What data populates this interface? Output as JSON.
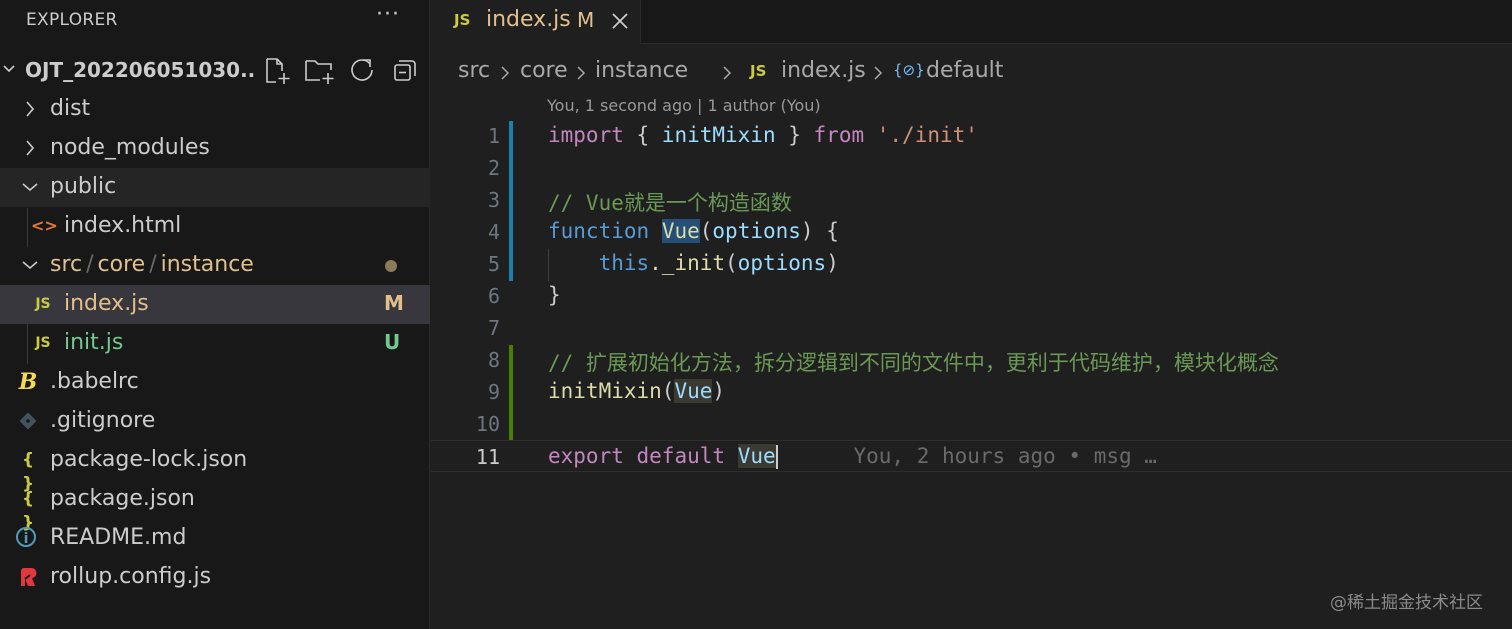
{
  "explorer": {
    "title": "EXPLORER",
    "more": "···",
    "project_name": "OJT_202206051030...",
    "items": [
      {
        "label": "dist",
        "icon": "chevron-right"
      },
      {
        "label": "node_modules",
        "icon": "chevron-right"
      },
      {
        "label": "public",
        "icon": "chevron-down"
      },
      {
        "label": "index.html",
        "icon": "html-icon"
      },
      {
        "label_parts": [
          "src",
          "core",
          "instance"
        ],
        "separator": "/",
        "icon": "chevron-down"
      },
      {
        "label": "index.js",
        "icon": "js-icon",
        "badge": "M"
      },
      {
        "label": "init.js",
        "icon": "js-icon",
        "badge": "U"
      },
      {
        "label": ".babelrc",
        "icon": "babel-icon"
      },
      {
        "label": ".gitignore",
        "icon": "git-icon"
      },
      {
        "label": "package-lock.json",
        "icon": "json-icon"
      },
      {
        "label": "package.json",
        "icon": "json-icon"
      },
      {
        "label": "README.md",
        "icon": "info-icon"
      },
      {
        "label": "rollup.config.js",
        "icon": "rollup-icon"
      }
    ],
    "icon_glyphs": {
      "js": "JS",
      "json": "{ }",
      "html": "<>",
      "babel": "B",
      "info": "i"
    }
  },
  "tab": {
    "file_icon": "JS",
    "name": "index.js",
    "status": "M"
  },
  "breadcrumb": {
    "parts": [
      "src",
      "core",
      "instance"
    ],
    "file_icon": "JS",
    "file": "index.js",
    "symbol_icon": "{⊘}",
    "symbol": "default"
  },
  "codelens": "You, 1 second ago | 1 author (You)",
  "code": {
    "line_numbers": [
      "1",
      "2",
      "3",
      "4",
      "5",
      "6",
      "7",
      "8",
      "9",
      "10",
      "11"
    ],
    "l1": {
      "kw1": "import",
      "p1": " { ",
      "name": "initMixin",
      "p2": " } ",
      "kw2": "from",
      "str": "'./init'"
    },
    "l3": "// Vue就是一个构造函数",
    "l4": {
      "kw": "function",
      "name": "Vue",
      "p1": "(",
      "arg": "options",
      "p2": ") {"
    },
    "l5": {
      "indent": "    ",
      "this": "this",
      "call": "._init",
      "p1": "(",
      "arg": "options",
      "p2": ")"
    },
    "l6": "}",
    "l8": "// 扩展初始化方法，拆分逻辑到不同的文件中，更利于代码维护，模块化概念",
    "l9": {
      "fn": "initMixin",
      "p1": "(",
      "arg": "Vue",
      "p2": ")"
    },
    "l11": {
      "kw1": "export",
      "kw2": "default",
      "name": "Vue",
      "blame": "You, 2 hours ago • msg …"
    }
  },
  "colors": {
    "modified": "#e2c08d",
    "untracked": "#73c991",
    "js": "#cbcb41",
    "added_bar": "#487e02",
    "modified_bar": "#1b81a8"
  },
  "watermark": "@稀土掘金技术社区"
}
